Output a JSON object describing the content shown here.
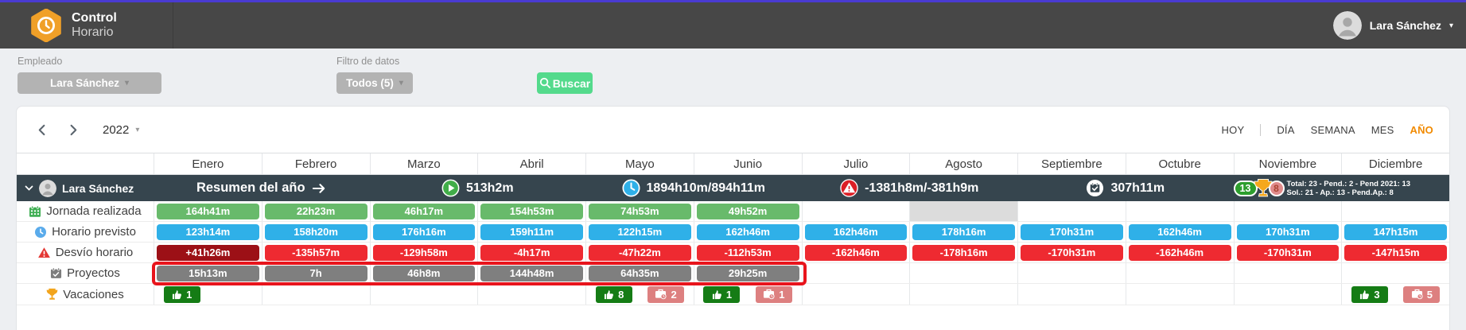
{
  "topbar": {
    "brand_line1": "Control",
    "brand_line2": "Horario",
    "user_name": "Lara Sánchez"
  },
  "filters": {
    "employee_label": "Empleado",
    "employee_value": "Lara Sánchez",
    "data_filter_label": "Filtro de datos",
    "data_filter_value": "Todos (5)",
    "search_label": "Buscar"
  },
  "toolbar": {
    "year": "2022",
    "views": [
      {
        "id": "hoy",
        "label": "HOY"
      },
      {
        "id": "dia",
        "label": "DÍA"
      },
      {
        "id": "semana",
        "label": "SEMANA"
      },
      {
        "id": "mes",
        "label": "MES"
      },
      {
        "id": "ano",
        "label": "AÑO",
        "active": true
      }
    ]
  },
  "colors": {
    "green": "#68ba6b",
    "blue": "#2fb0e8",
    "red": "#ee2a31",
    "dark_red": "#9c1016",
    "gray": "#7f7f7f",
    "badge_green": "#157c15",
    "badge_pink": "#dd8080",
    "accent_orange": "#f18a00",
    "annotation_red": "#e8141c"
  },
  "table": {
    "months": [
      "Enero",
      "Febrero",
      "Marzo",
      "Abril",
      "Mayo",
      "Junio",
      "Julio",
      "Agosto",
      "Septiembre",
      "Octubre",
      "Noviembre",
      "Diciembre"
    ],
    "employee_name": "Lara Sánchez",
    "summary": {
      "segments": [
        {
          "icon": "arrow-right-icon",
          "text": "Resumen del año"
        },
        {
          "icon": "play-icon",
          "text": "513h2m"
        },
        {
          "icon": "clock-icon",
          "text": "1894h10m/894h11m"
        },
        {
          "icon": "alert-icon",
          "text": "-1381h8m/-381h9m"
        },
        {
          "icon": "calendar-check-icon",
          "text": "307h11m"
        }
      ],
      "vacations": {
        "approved_total": "13",
        "pending_total": "8",
        "line1": "Total: 23 - Pend.: 2 - Pend 2021: 13",
        "line2": "Sol.: 21 - Ap.: 13 - Pend.Ap.: 8"
      }
    },
    "rows": [
      {
        "id": "jornada-realizada",
        "label": "Jornada realizada",
        "icon": "calendar-grid-icon",
        "type": "pills",
        "color": "green",
        "cells": [
          "164h41m",
          "22h23m",
          "46h17m",
          "154h53m",
          "74h53m",
          "49h52m",
          "",
          {
            "placeholder": true
          },
          "",
          "",
          "",
          ""
        ]
      },
      {
        "id": "horario-previsto",
        "label": "Horario previsto",
        "icon": "clock-blue-icon",
        "type": "pills",
        "color": "blue",
        "cells": [
          "123h14m",
          "158h20m",
          "176h16m",
          "159h11m",
          "122h15m",
          "162h46m",
          "162h46m",
          "178h16m",
          "170h31m",
          "162h46m",
          "170h31m",
          "147h15m"
        ]
      },
      {
        "id": "desvio-horario",
        "label": "Desvío horario",
        "icon": "warning-icon",
        "type": "pills",
        "color": "red",
        "cells": [
          {
            "v": "+41h26m",
            "variant": "dark"
          },
          "-135h57m",
          "-129h58m",
          "-4h17m",
          "-47h22m",
          "-112h53m",
          "-162h46m",
          "-178h16m",
          "-170h31m",
          "-162h46m",
          "-170h31m",
          "-147h15m"
        ]
      },
      {
        "id": "proyectos",
        "label": "Proyectos",
        "icon": "calendar-check-gray-icon",
        "type": "pills",
        "color": "gray",
        "cells": [
          "15h13m",
          "7h",
          "46h8m",
          "144h48m",
          "64h35m",
          "29h25m",
          "",
          "",
          "",
          "",
          "",
          ""
        ]
      },
      {
        "id": "vacaciones",
        "label": "Vacaciones",
        "icon": "trophy-icon",
        "type": "badges",
        "cells": [
          [
            {
              "type": "approved",
              "count": "1"
            }
          ],
          [],
          [],
          [],
          [
            {
              "type": "approved",
              "count": "8"
            },
            {
              "type": "pending",
              "count": "2"
            }
          ],
          [
            {
              "type": "approved",
              "count": "1"
            },
            {
              "type": "pending",
              "count": "1"
            }
          ],
          [],
          [],
          [],
          [],
          [],
          [
            {
              "type": "approved",
              "count": "3"
            },
            {
              "type": "pending",
              "count": "5"
            }
          ]
        ]
      }
    ]
  }
}
